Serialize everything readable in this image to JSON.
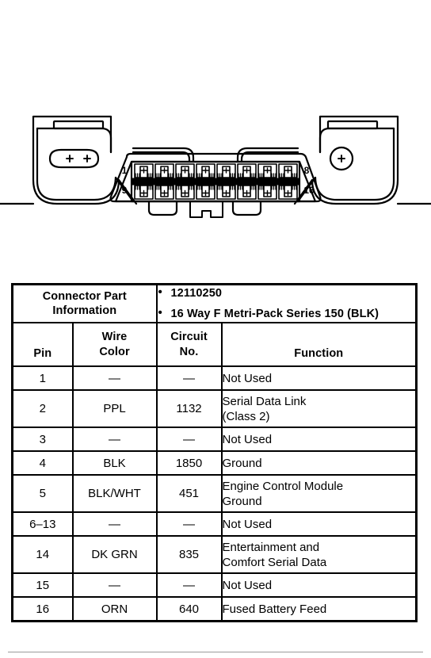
{
  "diagram": {
    "name": "obd-ii-dlc-connector-16-way",
    "pin_numbers": {
      "top_left": "1",
      "top_right": "8",
      "bottom_left": "9",
      "bottom_right": "16"
    },
    "cavity_count_per_row": 8,
    "row_count": 2
  },
  "table": {
    "part_info": {
      "label": "Connector Part\nInformation",
      "label_line1": "Connector Part",
      "label_line2": "Information",
      "bullets": [
        "12110250",
        "16 Way F Metri-Pack Series 150 (BLK)"
      ]
    },
    "headers": {
      "pin": "Pin",
      "wire_color_line1": "Wire",
      "wire_color_line2": "Color",
      "circuit_no_line1": "Circuit",
      "circuit_no_line2": "No.",
      "function": "Function"
    },
    "rows": [
      {
        "pin": "1",
        "wire": "—",
        "circuit": "—",
        "function": "Not Used",
        "lines": 1
      },
      {
        "pin": "2",
        "wire": "PPL",
        "circuit": "1132",
        "function": "Serial Data Link\n(Class 2)",
        "lines": 2
      },
      {
        "pin": "3",
        "wire": "—",
        "circuit": "—",
        "function": "Not Used",
        "lines": 1
      },
      {
        "pin": "4",
        "wire": "BLK",
        "circuit": "1850",
        "function": "Ground",
        "lines": 1
      },
      {
        "pin": "5",
        "wire": "BLK/WHT",
        "circuit": "451",
        "function": "Engine Control Module\nGround",
        "lines": 2
      },
      {
        "pin": "6–13",
        "wire": "—",
        "circuit": "—",
        "function": "Not Used",
        "lines": 1
      },
      {
        "pin": "14",
        "wire": "DK GRN",
        "circuit": "835",
        "function": "Entertainment and\nComfort Serial Data",
        "lines": 2
      },
      {
        "pin": "15",
        "wire": "—",
        "circuit": "—",
        "function": "Not Used",
        "lines": 1
      },
      {
        "pin": "16",
        "wire": "ORN",
        "circuit": "640",
        "function": "Fused Battery Feed",
        "lines": 1
      }
    ]
  },
  "colors": {
    "ink": "#000000",
    "paper": "#ffffff",
    "rule": "#9a9a9a"
  }
}
